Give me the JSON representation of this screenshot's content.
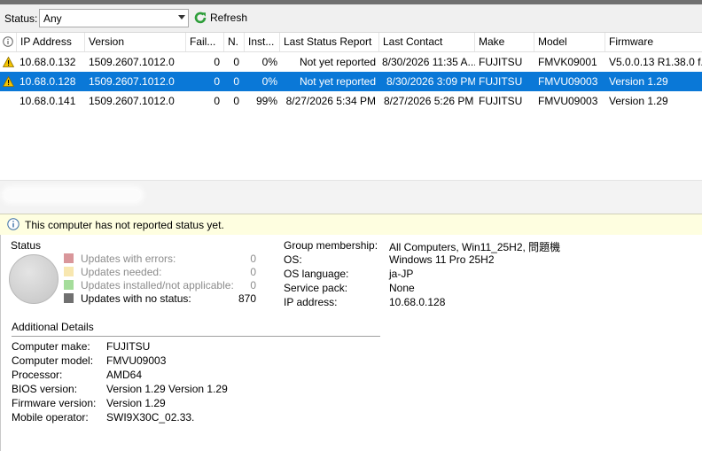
{
  "toolbar": {
    "status_label": "Status:",
    "status_value": "Any",
    "refresh_label": "Refresh"
  },
  "grid": {
    "columns": [
      "IP Address",
      "Version",
      "Fail...",
      "N.",
      "Inst...",
      "Last Status Report",
      "Last Contact",
      "Make",
      "Model",
      "Firmware"
    ],
    "rows": [
      {
        "warning": true,
        "ip": "10.68.0.132",
        "version": "1509.2607.1012.0",
        "failed": "0",
        "needed": "0",
        "installed": "0%",
        "last_status": "Not yet reported",
        "last_contact": "8/30/2026 11:35 A...",
        "make": "FUJITSU",
        "model": "FMVK09001",
        "firmware": "V5.0.0.13 R1.38.0 f..."
      },
      {
        "warning": true,
        "selected": true,
        "ip": "10.68.0.128",
        "version": "1509.2607.1012.0",
        "failed": "0",
        "needed": "0",
        "installed": "0%",
        "last_status": "Not yet reported",
        "last_contact": "8/30/2026 3:09 PM",
        "make": "FUJITSU",
        "model": "FMVU09003",
        "firmware": "Version 1.29"
      },
      {
        "warning": false,
        "ip": "10.68.0.141",
        "version": "1509.2607.1012.0",
        "failed": "0",
        "needed": "0",
        "installed": "99%",
        "last_status": "8/27/2026 5:34 PM",
        "last_contact": "8/27/2026 5:26 PM",
        "make": "FUJITSU",
        "model": "FMVU09003",
        "firmware": "Version 1.29"
      }
    ]
  },
  "infobar": {
    "text": "This computer has not reported status yet."
  },
  "status": {
    "title": "Status",
    "legend": [
      {
        "label": "Updates with errors:",
        "count": "0",
        "color": "#d9969a"
      },
      {
        "label": "Updates needed:",
        "count": "0",
        "color": "#f8e7b0"
      },
      {
        "label": "Updates installed/not applicable:",
        "count": "0",
        "color": "#a5dd9b"
      },
      {
        "label": "Updates with no status:",
        "count": "870",
        "color": "#707070"
      }
    ]
  },
  "props": [
    {
      "label": "Group membership:",
      "value": "All Computers, Win11_25H2, 問題機"
    },
    {
      "label": "OS:",
      "value": "Windows 11 Pro 25H2"
    },
    {
      "label": "OS language:",
      "value": "ja-JP"
    },
    {
      "label": "Service pack:",
      "value": "None"
    },
    {
      "label": "IP address:",
      "value": "10.68.0.128"
    }
  ],
  "additional": {
    "title": "Additional Details",
    "items": [
      {
        "label": "Computer make:",
        "value": "FUJITSU"
      },
      {
        "label": "Computer model:",
        "value": "FMVU09003"
      },
      {
        "label": "Processor:",
        "value": "AMD64"
      },
      {
        "label": "BIOS version:",
        "value": "Version 1.29 Version 1.29"
      },
      {
        "label": "Firmware version:",
        "value": "Version 1.29"
      },
      {
        "label": "Mobile operator:",
        "value": "SWI9X30C_02.33."
      }
    ]
  },
  "colors": {
    "selection": "#0a78d7",
    "info_bar": "#fefee0",
    "warning": "#f5c400"
  },
  "icons": [
    "refresh-icon",
    "info-icon",
    "warning-icon",
    "status-pie-icon"
  ]
}
